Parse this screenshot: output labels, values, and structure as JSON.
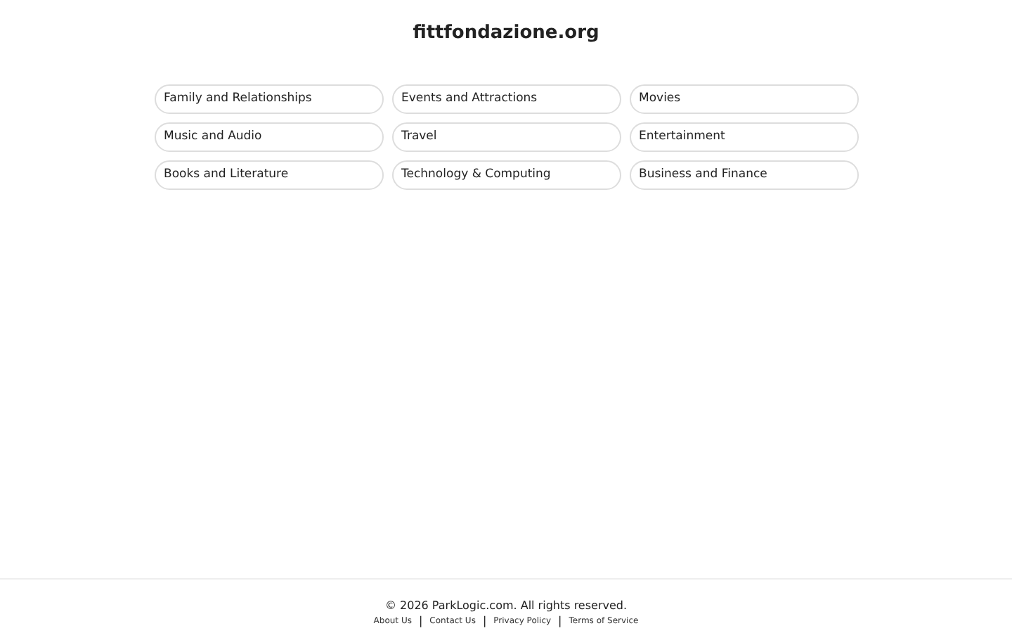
{
  "site_title": "fittfondazione.org",
  "links": [
    "Family and Relationships",
    "Events and Attractions",
    "Movies",
    "Music and Audio",
    "Travel",
    "Entertainment",
    "Books and Literature",
    "Technology & Computing",
    "Business and Finance"
  ],
  "footer": {
    "copyright": "© 2026 ParkLogic.com. All rights reserved.",
    "links": [
      "About Us",
      "Contact Us",
      "Privacy Policy",
      "Terms of Service"
    ],
    "separator": "|"
  }
}
